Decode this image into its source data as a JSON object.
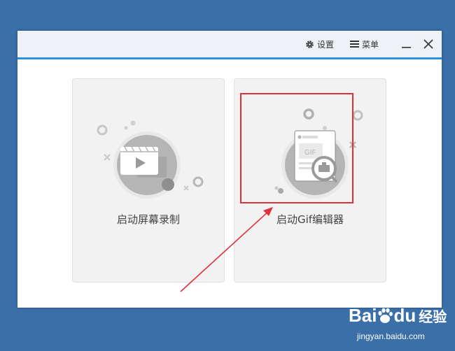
{
  "titlebar": {
    "settings_label": "设置",
    "menu_label": "菜单"
  },
  "cards": {
    "screen_record_label": "启动屏幕录制",
    "gif_editor_label": "启动Gif编辑器",
    "gif_doc_text": "GIF"
  },
  "watermark": {
    "brand_bai": "Bai",
    "brand_du": "du",
    "brand_jingyan": "经验",
    "url": "jingyan.baidu.com"
  },
  "colors": {
    "desktop": "#3a6fa8",
    "titlebar_accent": "#2f8fd8",
    "highlight_box": "#e0303a",
    "icon_gray": "#b5b5b5"
  },
  "icons": [
    "gear-icon",
    "hamburger-icon",
    "minimize-icon",
    "close-icon",
    "video-play-icon",
    "gif-document-icon",
    "magnifier-icon"
  ]
}
